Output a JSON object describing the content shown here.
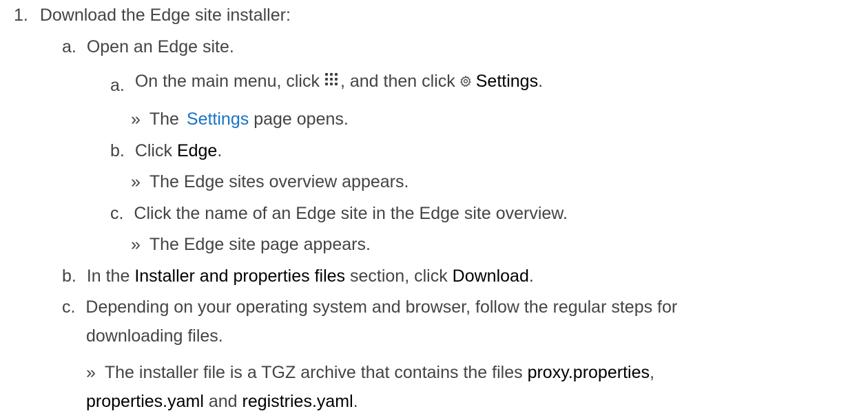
{
  "steps": {
    "s1": {
      "num": "1.",
      "text": "Download the Edge site installer:"
    },
    "sa": {
      "num": "a.",
      "text": "Open an Edge site."
    },
    "sa_a": {
      "num": "a.",
      "pre": "On the main menu, click",
      "mid": ", and then click",
      "settings": "Settings",
      "end": "."
    },
    "sa_a_result": {
      "marker": "»",
      "pre": "The",
      "link": "Settings",
      "post": "page opens."
    },
    "sa_b": {
      "num": "b.",
      "pre": "Click",
      "bold": "Edge",
      "end": "."
    },
    "sa_b_result": {
      "marker": "»",
      "text": "The Edge sites overview appears."
    },
    "sa_c": {
      "num": "c.",
      "text": "Click the name of an Edge site in the Edge site overview."
    },
    "sa_c_result": {
      "marker": "»",
      "text": "The Edge site page appears."
    },
    "sb": {
      "num": "b.",
      "pre": "In the",
      "bold1": "Installer and properties files",
      "mid": "section, click",
      "bold2": "Download",
      "end": "."
    },
    "sc": {
      "num": "c.",
      "line1": "Depending on your operating system and browser, follow the regular steps for",
      "line2": "downloading files."
    },
    "sc_result": {
      "marker": "»",
      "pre": "The installer file is a TGZ archive that contains the files",
      "file1": "proxy.properties",
      "comma": ",",
      "file2": "properties.yaml",
      "and": "and",
      "file3": "registries.yaml",
      "end": "."
    }
  },
  "icons": {
    "apps": "grid-icon",
    "settings": "gear-icon"
  },
  "colors": {
    "text": "#444444",
    "bold": "#000000",
    "link": "#1a73c8"
  }
}
